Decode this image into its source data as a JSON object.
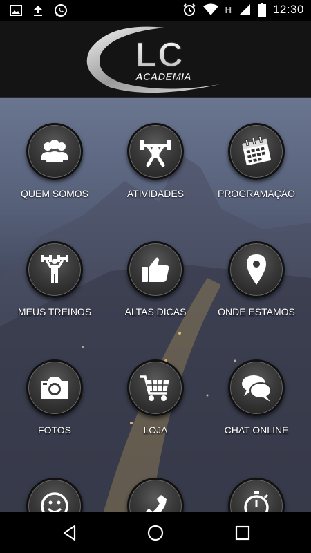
{
  "status_bar": {
    "left_icons": [
      "image-icon",
      "upload-icon",
      "whatsapp-icon"
    ],
    "right_icons": [
      "alarm-icon",
      "wifi-icon",
      "signal-icon",
      "battery-icon"
    ],
    "network": "H",
    "time": "12:30"
  },
  "header": {
    "logo_text": "LC",
    "logo_subtext": "ACADEMIA"
  },
  "menu": [
    {
      "label": "QUEM SOMOS",
      "icon": "group-icon"
    },
    {
      "label": "ATIVIDADES",
      "icon": "weightlifter-icon"
    },
    {
      "label": "PROGRAMAÇÃO",
      "icon": "calendar-icon"
    },
    {
      "label": "MEUS TREINOS",
      "icon": "dumbbell-person-icon"
    },
    {
      "label": "ALTAS DICAS",
      "icon": "thumbs-up-icon"
    },
    {
      "label": "ONDE ESTAMOS",
      "icon": "map-pin-icon"
    },
    {
      "label": "FOTOS",
      "icon": "camera-icon"
    },
    {
      "label": "LOJA",
      "icon": "shopping-cart-icon"
    },
    {
      "label": "CHAT ONLINE",
      "icon": "chat-bubbles-icon"
    },
    {
      "label": "",
      "icon": "smiley-icon"
    },
    {
      "label": "",
      "icon": "phone-icon"
    },
    {
      "label": "",
      "icon": "stopwatch-icon"
    }
  ],
  "nav": {
    "icons": [
      "back-icon",
      "home-icon",
      "recents-icon"
    ]
  }
}
